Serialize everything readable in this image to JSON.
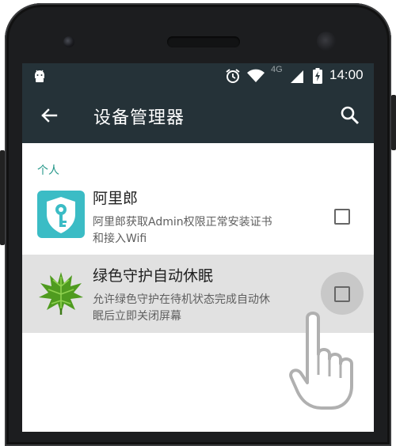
{
  "status_bar": {
    "network": "4G",
    "time": "14:00"
  },
  "app_bar": {
    "title": "设备管理器"
  },
  "section": {
    "header": "个人"
  },
  "items": [
    {
      "title": "阿里郎",
      "summary_line1": "阿里郎获取Admin权限正常安装证书",
      "summary_line2": "和接入Wifi",
      "checked": false
    },
    {
      "title": "绿色守护自动休眠",
      "summary_line1": "允许绿色守护在待机状态完成自动休",
      "summary_line2": "眠后立即关闭屏幕",
      "checked": false
    }
  ],
  "colors": {
    "app_bar_bg": "#253238",
    "accent_teal": "#239688",
    "pressed_row_bg": "#e1e1e1",
    "aliyun_icon_bg": "#3bbcc5",
    "leaf_green": "#4f9b1f"
  }
}
